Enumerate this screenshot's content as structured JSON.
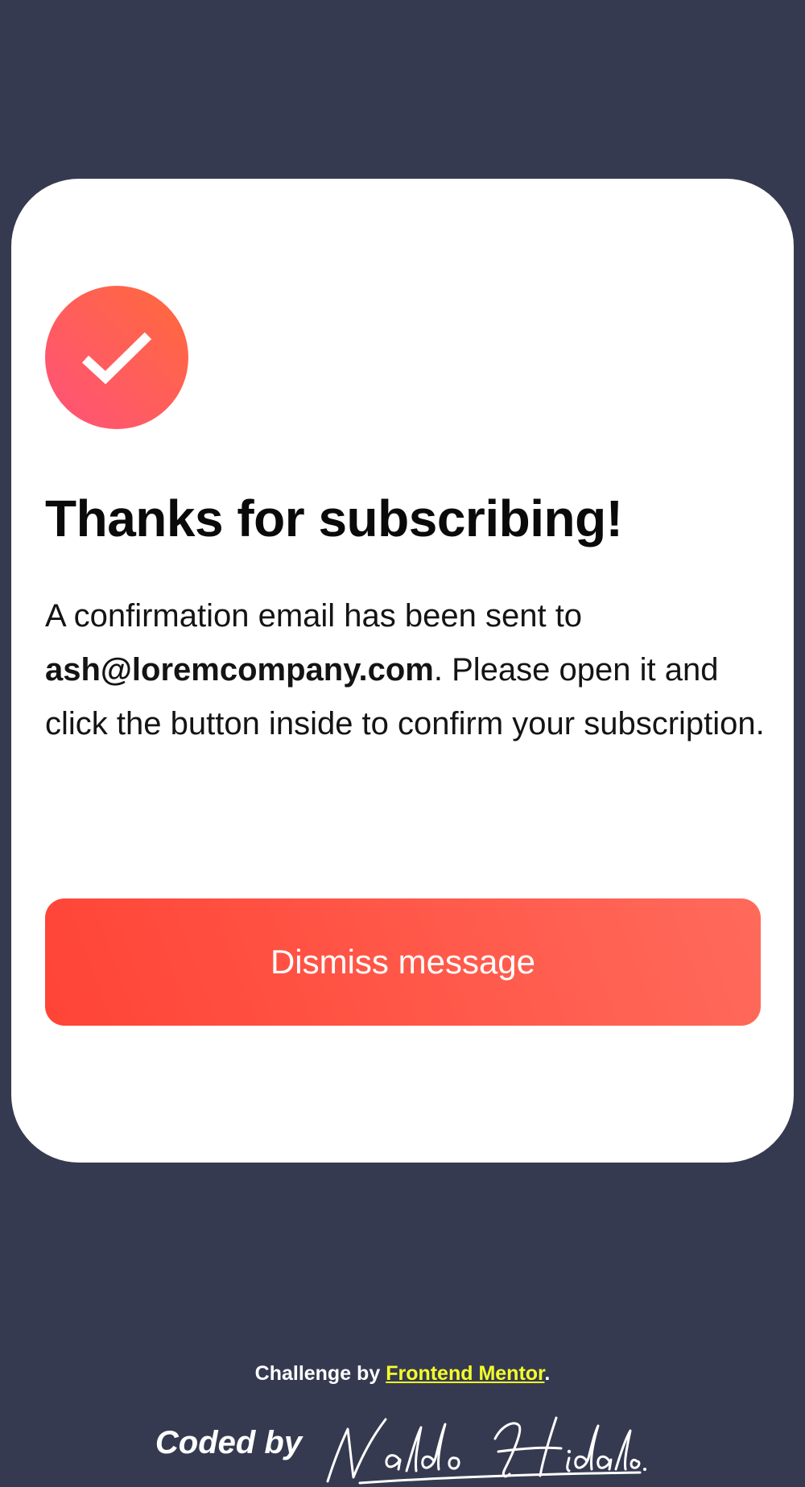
{
  "card": {
    "title": "Thanks for subscribing!",
    "message_prefix": "A confirmation email has been sent to ",
    "email": "ash@loremcompany.com",
    "message_suffix": ". Please open it and click the button inside to confirm your subscription.",
    "dismiss_label": "Dismiss message",
    "badge_icon": "checkmark-icon"
  },
  "footer": {
    "challenge_prefix": "Challenge by ",
    "challenge_link": "Frontend Mentor",
    "challenge_suffix": ".",
    "coded_by_label": "Coded by",
    "author_signature": "Waldo Hidalgo"
  },
  "colors": {
    "background": "#363a50",
    "card": "#ffffff",
    "accent_gradient_start": "#ff4436",
    "accent_gradient_end": "#ff6a5b",
    "link": "#f5ff2a"
  }
}
